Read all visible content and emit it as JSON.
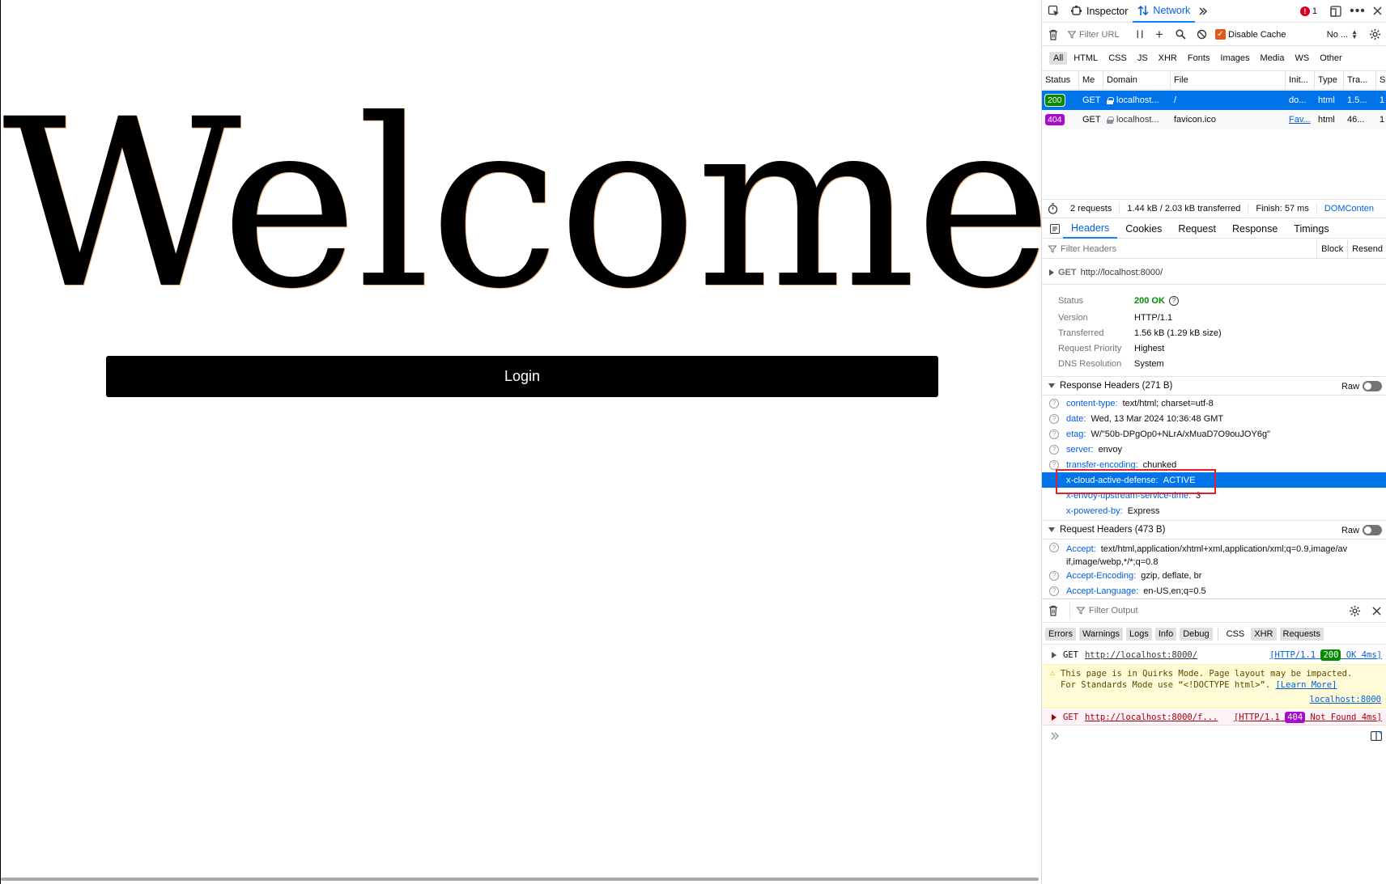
{
  "page": {
    "heading": "Welcome",
    "login_label": "Login"
  },
  "devtools": {
    "toolbar": {
      "tab_inspector": "Inspector",
      "tab_network": "Network",
      "error_count": "1"
    },
    "filterbar": {
      "filter_placeholder": "Filter URL",
      "pause_label": "| |",
      "disable_cache_label": "Disable Cache",
      "throttle_label": "No ..."
    },
    "type_filters": [
      "All",
      "HTML",
      "CSS",
      "JS",
      "XHR",
      "Fonts",
      "Images",
      "Media",
      "WS",
      "Other"
    ],
    "columns": {
      "status": "Status",
      "method": "Me",
      "domain": "Domain",
      "file": "File",
      "initiator": "Init...",
      "type": "Type",
      "transferred": "Tra...",
      "size": "S"
    },
    "requests": [
      {
        "status": "200",
        "method": "GET",
        "domain": "localhost...",
        "file": "/",
        "initiator": "do...",
        "type": "html",
        "transferred": "1.5...",
        "size": "1"
      },
      {
        "status": "404",
        "method": "GET",
        "domain": "localhost...",
        "file": "favicon.ico",
        "initiator": "Fav...",
        "type": "html",
        "transferred": "46...",
        "size": "1"
      }
    ],
    "summary": {
      "requests": "2 requests",
      "size": "1.44 kB / 2.03 kB transferred",
      "finish": "Finish: 57 ms",
      "dom": "DOMConten"
    },
    "detail_tabs": [
      "Headers",
      "Cookies",
      "Request",
      "Response",
      "Timings"
    ],
    "filter_headers": {
      "placeholder": "Filter Headers",
      "block": "Block",
      "resend": "Resend"
    },
    "request_line": {
      "method": "GET",
      "url": "http://localhost:8000/"
    },
    "general": {
      "status_label": "Status",
      "status_value": "200 OK",
      "version_label": "Version",
      "version_value": "HTTP/1.1",
      "transferred_label": "Transferred",
      "transferred_value": "1.56 kB (1.29 kB size)",
      "priority_label": "Request Priority",
      "priority_value": "Highest",
      "dns_label": "DNS Resolution",
      "dns_value": "System"
    },
    "response_headers": {
      "title": "Response Headers (271 B)",
      "raw": "Raw",
      "items": [
        {
          "name": "content-type:",
          "value": "text/html; charset=utf-8"
        },
        {
          "name": "date:",
          "value": "Wed, 13 Mar 2024 10:36:48 GMT"
        },
        {
          "name": "etag:",
          "value": "W/\"50b-DPgOp0+NLrA/xMuaD7O9ouJOY6g\""
        },
        {
          "name": "server:",
          "value": "envoy"
        },
        {
          "name": "transfer-encoding:",
          "value": "chunked"
        },
        {
          "name": "x-cloud-active-defense:",
          "value": "ACTIVE"
        },
        {
          "name": "x-envoy-upstream-service-time:",
          "value": "3"
        },
        {
          "name": "x-powered-by:",
          "value": "Express"
        }
      ]
    },
    "request_headers": {
      "title": "Request Headers (473 B)",
      "raw": "Raw",
      "items": [
        {
          "name": "Accept:",
          "value": "text/html,application/xhtml+xml,application/xml;q=0.9,image/av",
          "value2": "if,image/webp,*/*;q=0.8"
        },
        {
          "name": "Accept-Encoding:",
          "value": "gzip, deflate, br"
        },
        {
          "name": "Accept-Language:",
          "value": "en-US,en;q=0.5"
        }
      ]
    },
    "console": {
      "filter_placeholder": "Filter Output",
      "filters": [
        "Errors",
        "Warnings",
        "Logs",
        "Info",
        "Debug",
        "CSS",
        "XHR",
        "Requests"
      ],
      "msg1": {
        "method": "GET",
        "url": "http://localhost:8000/",
        "meta_pre": "[HTTP/1.1",
        "code": "200",
        "meta_post": "OK 4ms]"
      },
      "msg2": {
        "line1": "This page is in Quirks Mode. Page layout may be impacted.",
        "line2": "For Standards Mode use “<!DOCTYPE html>”.",
        "link": "[Learn More]",
        "source": "localhost:8000"
      },
      "msg3": {
        "method": "GET",
        "url": "http://localhost:8000/f...",
        "meta_pre": "[HTTP/1.1",
        "code": "404",
        "meta_post": "Not Found 4ms]"
      }
    }
  }
}
